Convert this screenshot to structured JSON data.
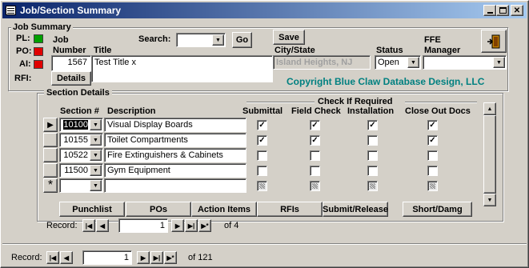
{
  "window": {
    "title": "Job/Section Summary",
    "title_bg": "#0a246a"
  },
  "job_summary": {
    "legend": "Job Summary",
    "pl_label": "PL:",
    "po_label": "PO:",
    "ai_label": "AI:",
    "rfi_label": "RFI:",
    "job_number_label_1": "Job",
    "job_number_label_2": "Number",
    "job_number": "1567",
    "title_label": "Title",
    "title_value": "Test Title x",
    "search_label": "Search:",
    "search_value": "",
    "go_label": "Go",
    "save_label": "Save",
    "city_label": "City/State",
    "city_value": "Island Heights, NJ",
    "status_label": "Status",
    "status_value": "Open",
    "ffe_label_1": "FFE",
    "ffe_label_2": "Manager",
    "ffe_value": "",
    "details_label": "Details",
    "copyright": "Copyright Blue Claw Database Design, LLC",
    "indicator_colors": {
      "pl": "#00a000",
      "po": "#e00000",
      "ai": "#e00000"
    }
  },
  "section_details": {
    "legend": "Section Details",
    "check_if_required": "Check If Required",
    "columns": {
      "section": "Section #",
      "description": "Description",
      "submittal": "Submittal",
      "field_check": "Field Check",
      "installation": "Installation",
      "close_out": "Close Out Docs"
    },
    "rows": [
      {
        "section": "10100",
        "description": "Visual Display Boards",
        "submittal": true,
        "field_check": true,
        "installation": true,
        "close_out": true
      },
      {
        "section": "10155",
        "description": "Toilet Compartments",
        "submittal": true,
        "field_check": true,
        "installation": false,
        "close_out": true
      },
      {
        "section": "10522",
        "description": "Fire Extinguishers & Cabinets",
        "submittal": false,
        "field_check": false,
        "installation": false,
        "close_out": false
      },
      {
        "section": "11500",
        "description": "Gym Equipment",
        "submittal": false,
        "field_check": false,
        "installation": false,
        "close_out": false
      }
    ],
    "new_row_marker": "*",
    "current_row_marker": "▶",
    "tabs": [
      "Punchlist",
      "POs",
      "Action Items",
      "RFIs",
      "Submit/Release",
      "Short/Damg"
    ],
    "record_label": "Record:",
    "record_current": "1",
    "record_of": "of 4"
  },
  "outer_nav": {
    "record_label": "Record:",
    "record_current": "1",
    "record_of": "of 121"
  },
  "copyright_color": "#008080"
}
